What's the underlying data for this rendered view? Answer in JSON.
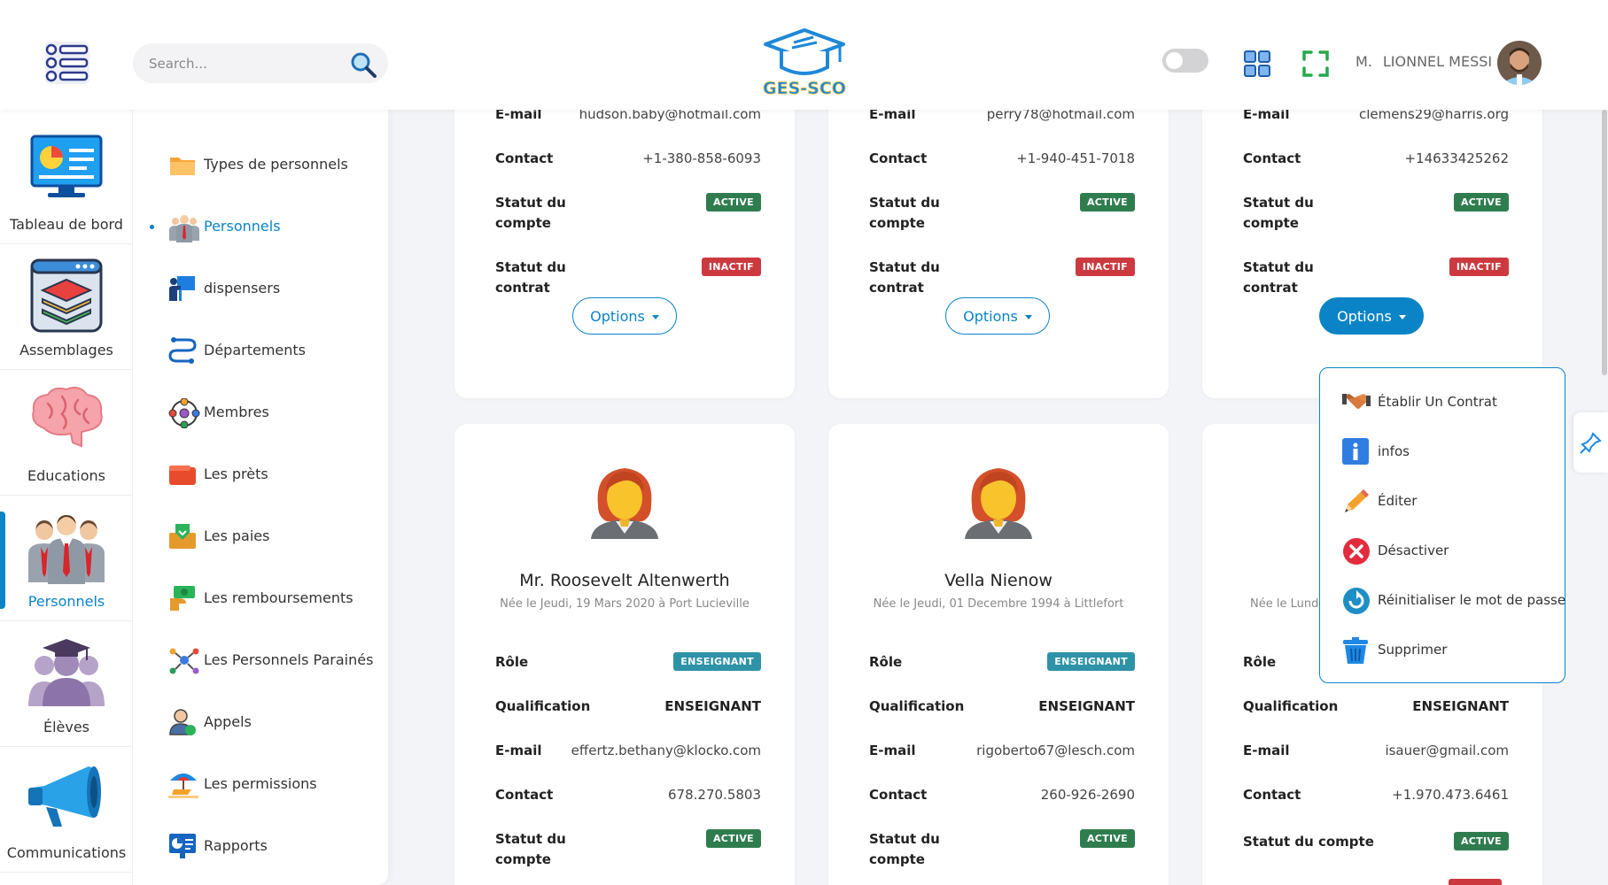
{
  "header": {
    "search_placeholder": "Search...",
    "logo_text": "GES-SCO",
    "user_prefix": "M.",
    "user_name": "LIONNEL MESSI"
  },
  "rail": [
    {
      "label": "Tableau de bord",
      "icon": "dashboard-icon"
    },
    {
      "label": "Assemblages",
      "icon": "layers-icon"
    },
    {
      "label": "Educations",
      "icon": "brain-icon"
    },
    {
      "label": "Personnels",
      "icon": "staff-icon",
      "active": true
    },
    {
      "label": "Élèves",
      "icon": "students-icon"
    },
    {
      "label": "Communications",
      "icon": "megaphone-icon"
    }
  ],
  "submenu": [
    {
      "label": "Types de personnels",
      "icon": "folder-icon"
    },
    {
      "label": "Personnels",
      "icon": "staff-icon",
      "active": true
    },
    {
      "label": "dispensers",
      "icon": "presenter-icon"
    },
    {
      "label": "Départements",
      "icon": "route-icon"
    },
    {
      "label": "Membres",
      "icon": "network-icon"
    },
    {
      "label": "Les prèts",
      "icon": "wallet-icon"
    },
    {
      "label": "Les paies",
      "icon": "payment-icon"
    },
    {
      "label": "Les remboursements",
      "icon": "refund-icon"
    },
    {
      "label": "Les Personnels Parainés",
      "icon": "sponsor-icon"
    },
    {
      "label": "Appels",
      "icon": "call-icon"
    },
    {
      "label": "Les permissions",
      "icon": "beach-icon"
    },
    {
      "label": "Rapports",
      "icon": "report-icon"
    }
  ],
  "labels": {
    "email": "E-mail",
    "contact": "Contact",
    "statut_compte_1": "Statut du",
    "statut_compte_2": "compte",
    "statut_contrat_1": "Statut du",
    "statut_contrat_2": "contrat",
    "statut_compte_full": "Statut du compte",
    "role": "Rôle",
    "qualification": "Qualification",
    "options": "Options"
  },
  "cards_top": [
    {
      "email": "hudson.baby@hotmail.com",
      "contact": "+1-380-858-6093",
      "account_status": "ACTIVE",
      "contract_status": "INACTIF"
    },
    {
      "email": "perry78@hotmail.com",
      "contact": "+1-940-451-7018",
      "account_status": "ACTIVE",
      "contract_status": "INACTIF"
    },
    {
      "email": "clemens29@harris.org",
      "contact": "+14633425262",
      "account_status": "ACTIVE",
      "contract_status": "INACTIF"
    }
  ],
  "cards_bottom": [
    {
      "name": "Mr. Roosevelt Altenwerth",
      "birth": "Née le Jeudi, 19 Mars 2020 à Port Lucieville",
      "role": "ENSEIGNANT",
      "qualification": "ENSEIGNANT",
      "email": "effertz.bethany@klocko.com",
      "contact": "678.270.5803",
      "account_status": "ACTIVE"
    },
    {
      "name": "Vella Nienow",
      "birth": "Née le Jeudi, 01 Decembre 1994 à Littlefort",
      "role": "ENSEIGNANT",
      "qualification": "ENSEIGNANT",
      "email": "rigoberto67@lesch.com",
      "contact": "260-926-2690",
      "account_status": "ACTIVE"
    },
    {
      "name": "",
      "birth": "Née le Lundi",
      "role": "",
      "qualification": "ENSEIGNANT",
      "email": "isauer@gmail.com",
      "contact": "+1.970.473.6461",
      "account_status": "ACTIVE"
    }
  ],
  "dropdown": [
    {
      "label": "Établir Un Contrat",
      "icon": "handshake-icon"
    },
    {
      "label": "infos",
      "icon": "info-icon"
    },
    {
      "label": "Éditer",
      "icon": "pencil-icon"
    },
    {
      "label": "Désactiver",
      "icon": "deactivate-icon"
    },
    {
      "label": "Réinitialiser le mot de passe",
      "icon": "reset-icon"
    },
    {
      "label": "Supprimer",
      "icon": "trash-icon"
    }
  ],
  "colors": {
    "accent": "#0a84c6",
    "active_badge": "#2f7d4f",
    "inactive_badge": "#cc3a40",
    "role_badge": "#2e93a7"
  }
}
